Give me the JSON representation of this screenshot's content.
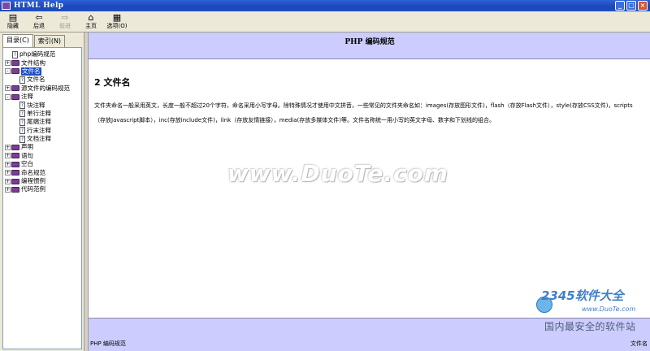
{
  "window": {
    "title": "HTML Help",
    "buttons": {
      "minimize": "_",
      "maximize": "□",
      "close": "×"
    }
  },
  "toolbar": {
    "items": [
      {
        "label": "隐藏",
        "icon": "hide-icon",
        "glyph": "▤",
        "enabled": true
      },
      {
        "label": "后退",
        "icon": "back-arrow-icon",
        "glyph": "⇦",
        "enabled": true
      },
      {
        "label": "前进",
        "icon": "forward-arrow-icon",
        "glyph": "⇨",
        "enabled": false
      },
      {
        "label": "主页",
        "icon": "home-icon",
        "glyph": "⌂",
        "enabled": true
      },
      {
        "label": "选项(O)",
        "icon": "options-icon",
        "glyph": "▦",
        "enabled": true
      }
    ]
  },
  "tabs": [
    {
      "label": "目录(C)",
      "active": true
    },
    {
      "label": "索引(N)",
      "active": false
    }
  ],
  "tree": [
    {
      "label": "php编码规范",
      "type": "page",
      "level": 1,
      "expander": ""
    },
    {
      "label": "文件结构",
      "type": "book",
      "level": 0,
      "expander": "+"
    },
    {
      "label": "文件名",
      "type": "book",
      "level": 0,
      "expander": "-",
      "selected": true
    },
    {
      "label": "文件名",
      "type": "page",
      "level": 2,
      "expander": ""
    },
    {
      "label": "源文件的编码规范",
      "type": "book",
      "level": 0,
      "expander": "+"
    },
    {
      "label": "注释",
      "type": "book",
      "level": 0,
      "expander": "-"
    },
    {
      "label": "块注释",
      "type": "page",
      "level": 2,
      "expander": ""
    },
    {
      "label": "单行注释",
      "type": "page",
      "level": 2,
      "expander": ""
    },
    {
      "label": "尾端注释",
      "type": "page",
      "level": 2,
      "expander": ""
    },
    {
      "label": "行末注释",
      "type": "page",
      "level": 2,
      "expander": ""
    },
    {
      "label": "文档注释",
      "type": "page",
      "level": 2,
      "expander": ""
    },
    {
      "label": "声明",
      "type": "book",
      "level": 0,
      "expander": "+"
    },
    {
      "label": "语句",
      "type": "book",
      "level": 0,
      "expander": "+"
    },
    {
      "label": "空白",
      "type": "book",
      "level": 0,
      "expander": "+"
    },
    {
      "label": "命名规范",
      "type": "book",
      "level": 0,
      "expander": "+"
    },
    {
      "label": "编程惯例",
      "type": "book",
      "level": 0,
      "expander": "+"
    },
    {
      "label": "代码范例",
      "type": "book",
      "level": 0,
      "expander": "+"
    }
  ],
  "content": {
    "header_title": "PHP 编码规范",
    "section_title": "2 文件名",
    "paragraph": "文件夹命名一般采用英文，长度一般不超过20个字符，命名采用小写字母。除特殊情况才使用中文拼音，一些常见的文件夹命名如：images(存放图形文件)，flash（存放Flash文件），style(存放CSS文件)，scripts（存放Javascript脚本），inc(存放include文件)，link（存放友情链接），media(存放多媒体文件)等。文件名称统一用小写的英文字母、数字和下划线的组合。",
    "footer_left": "PHP 编码规范",
    "footer_right": "文件名"
  },
  "watermarks": {
    "center": "www.DuoTe.com",
    "corner_logo": "2345软件大全",
    "corner_url": "www.DuoTe.com",
    "corner_caption": "国内最安全的软件站"
  }
}
